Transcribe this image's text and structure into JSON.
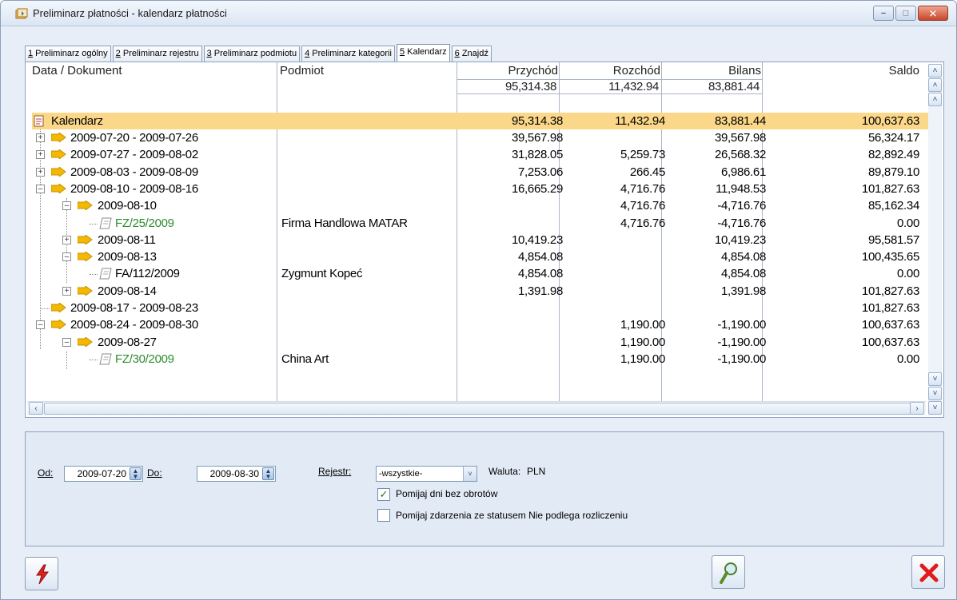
{
  "window": {
    "title": "Preliminarz płatności - kalendarz płatności"
  },
  "tabs": [
    {
      "key": "1",
      "label": " Preliminarz ogólny"
    },
    {
      "key": "2",
      "label": " Preliminarz rejestru"
    },
    {
      "key": "3",
      "label": " Preliminarz podmiotu"
    },
    {
      "key": "4",
      "label": " Preliminarz kategorii"
    },
    {
      "key": "5",
      "label": " Kalendarz"
    },
    {
      "key": "6",
      "label": " Znajdź"
    }
  ],
  "grid": {
    "headers": {
      "doc": "Data / Dokument",
      "podmiot": "Podmiot",
      "przychod": "Przychód",
      "rozchod": "Rozchód",
      "bilans": "Bilans",
      "saldo": "Saldo"
    },
    "totals": {
      "przychod": "95,314.38",
      "rozchod": "11,432.94",
      "bilans": "83,881.44"
    },
    "rows": [
      {
        "label": "Kalendarz",
        "podmiot": "",
        "przychod": "95,314.38",
        "rozchod": "11,432.94",
        "bilans": "83,881.44",
        "saldo": "100,637.63"
      },
      {
        "label": "2009-07-20 - 2009-07-26",
        "podmiot": "",
        "przychod": "39,567.98",
        "rozchod": "",
        "bilans": "39,567.98",
        "saldo": "56,324.17"
      },
      {
        "label": "2009-07-27 - 2009-08-02",
        "podmiot": "",
        "przychod": "31,828.05",
        "rozchod": "5,259.73",
        "bilans": "26,568.32",
        "saldo": "82,892.49"
      },
      {
        "label": "2009-08-03 - 2009-08-09",
        "podmiot": "",
        "przychod": "7,253.06",
        "rozchod": "266.45",
        "bilans": "6,986.61",
        "saldo": "89,879.10"
      },
      {
        "label": "2009-08-10 - 2009-08-16",
        "podmiot": "",
        "przychod": "16,665.29",
        "rozchod": "4,716.76",
        "bilans": "11,948.53",
        "saldo": "101,827.63"
      },
      {
        "label": "2009-08-10",
        "podmiot": "",
        "przychod": "",
        "rozchod": "4,716.76",
        "bilans": "-4,716.76",
        "saldo": "85,162.34"
      },
      {
        "label": "FZ/25/2009",
        "podmiot": "Firma Handlowa MATAR",
        "przychod": "",
        "rozchod": "4,716.76",
        "bilans": "-4,716.76",
        "saldo": "0.00"
      },
      {
        "label": "2009-08-11",
        "podmiot": "",
        "przychod": "10,419.23",
        "rozchod": "",
        "bilans": "10,419.23",
        "saldo": "95,581.57"
      },
      {
        "label": "2009-08-13",
        "podmiot": "",
        "przychod": "4,854.08",
        "rozchod": "",
        "bilans": "4,854.08",
        "saldo": "100,435.65"
      },
      {
        "label": "FA/112/2009",
        "podmiot": "Zygmunt Kopeć",
        "przychod": "4,854.08",
        "rozchod": "",
        "bilans": "4,854.08",
        "saldo": "0.00"
      },
      {
        "label": "2009-08-14",
        "podmiot": "",
        "przychod": "1,391.98",
        "rozchod": "",
        "bilans": "1,391.98",
        "saldo": "101,827.63"
      },
      {
        "label": "2009-08-17 - 2009-08-23",
        "podmiot": "",
        "przychod": "",
        "rozchod": "",
        "bilans": "",
        "saldo": "101,827.63"
      },
      {
        "label": "2009-08-24 - 2009-08-30",
        "podmiot": "",
        "przychod": "",
        "rozchod": "1,190.00",
        "bilans": "-1,190.00",
        "saldo": "100,637.63"
      },
      {
        "label": "2009-08-27",
        "podmiot": "",
        "przychod": "",
        "rozchod": "1,190.00",
        "bilans": "-1,190.00",
        "saldo": "100,637.63"
      },
      {
        "label": "FZ/30/2009",
        "podmiot": "China Art",
        "przychod": "",
        "rozchod": "1,190.00",
        "bilans": "-1,190.00",
        "saldo": "0.00"
      }
    ]
  },
  "filters": {
    "od_label": "Od:",
    "od_value": "2009-07-20",
    "do_label": "Do:",
    "do_value": "2009-08-30",
    "rejestr_label": "Rejestr:",
    "rejestr_value": "-wszystkie-",
    "waluta_label": "Waluta:",
    "waluta_value": "PLN",
    "opt1_label": "Pomijaj dni bez obrotów",
    "opt1_checked": true,
    "opt2_label": "Pomijaj zdarzenia ze statusem Nie podlega rozliczeniu",
    "opt2_checked": false
  },
  "colors": {
    "highlight": "#fbd789",
    "document_green": "#2f8c2f",
    "folder": "#f4b800"
  }
}
